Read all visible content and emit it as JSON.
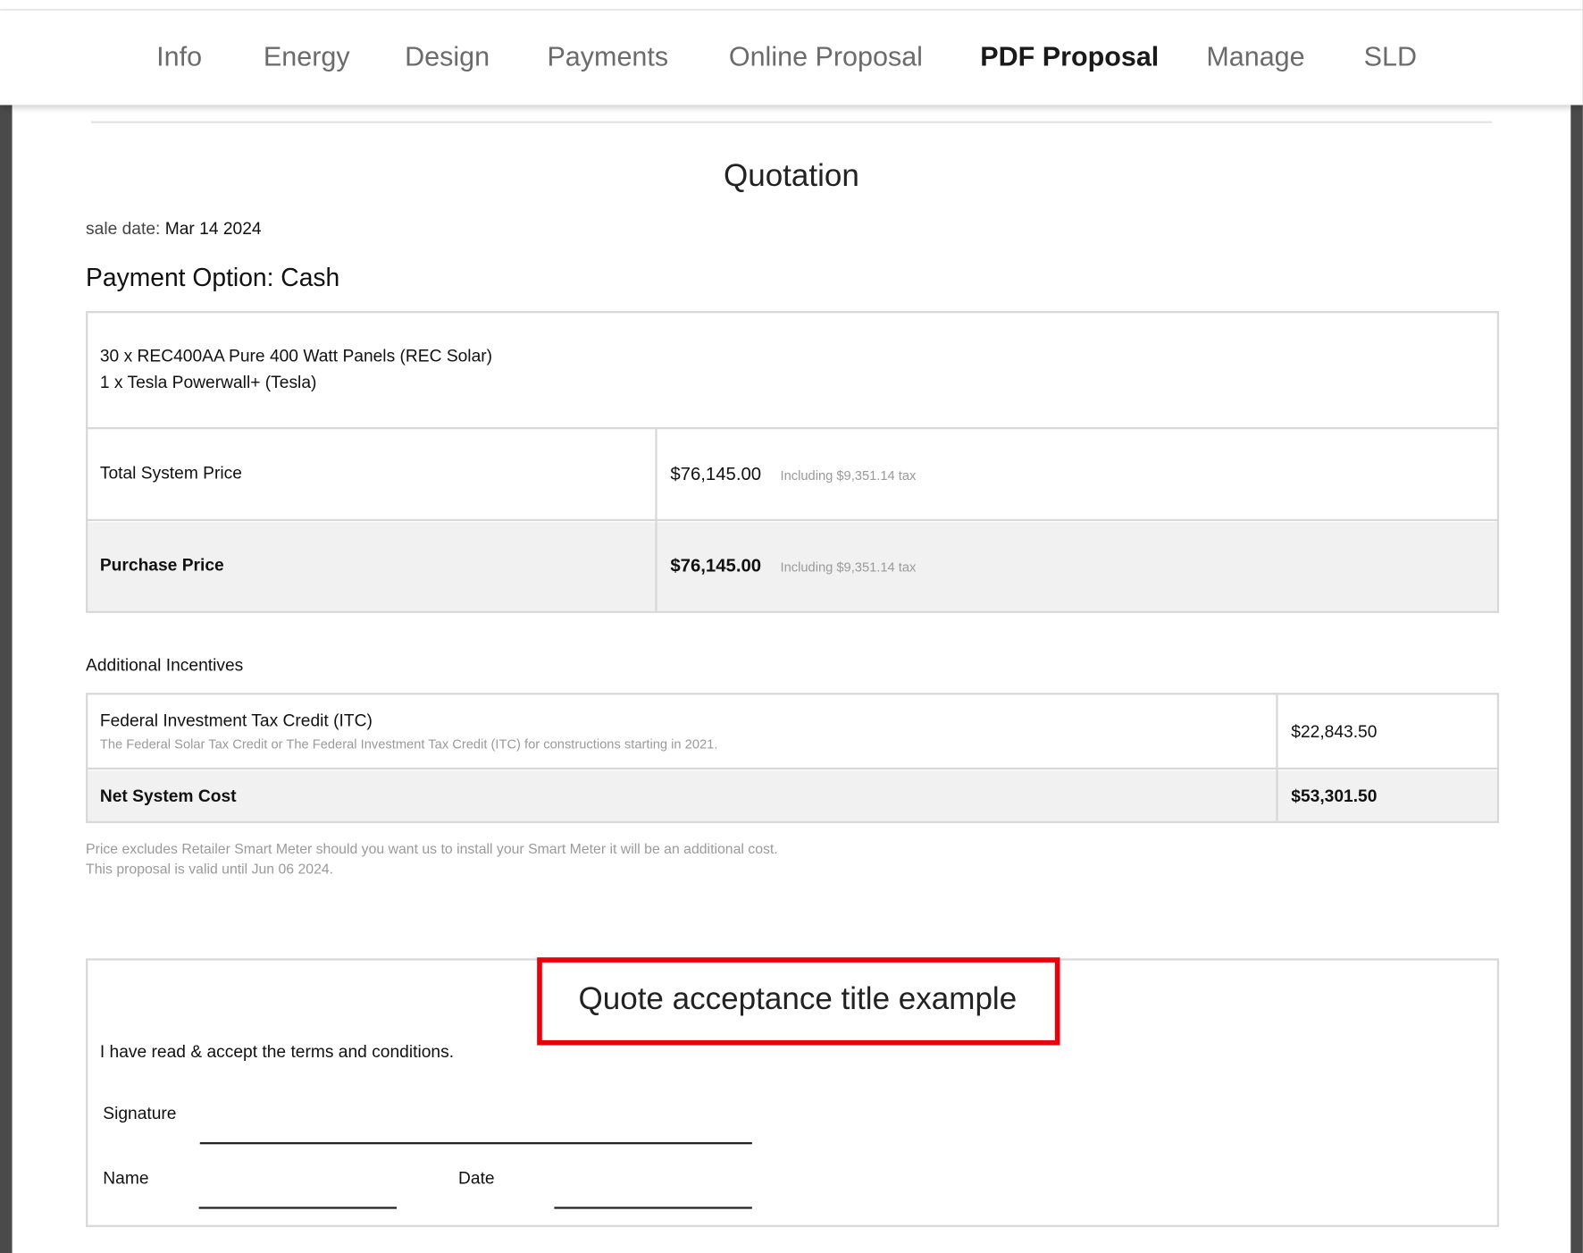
{
  "tabs": [
    {
      "label": "Info"
    },
    {
      "label": "Energy"
    },
    {
      "label": "Design"
    },
    {
      "label": "Payments"
    },
    {
      "label": "Online Proposal"
    },
    {
      "label": "PDF Proposal",
      "active": true
    },
    {
      "label": "Manage"
    },
    {
      "label": "SLD"
    }
  ],
  "document": {
    "title": "Quotation",
    "sale_date_label": "sale date:",
    "sale_date_value": "Mar 14 2024",
    "payment_option": "Payment Option: Cash",
    "system_lines": [
      "30 x REC400AA Pure 400 Watt Panels (REC Solar)",
      "1 x Tesla Powerwall+ (Tesla)"
    ],
    "total_system_price": {
      "label": "Total System Price",
      "value": "$76,145.00",
      "tax_note": "Including $9,351.14 tax"
    },
    "purchase_price": {
      "label": "Purchase Price",
      "value": "$76,145.00",
      "tax_note": "Including $9,351.14 tax"
    },
    "incentives_heading": "Additional Incentives",
    "itc": {
      "label": "Federal Investment Tax Credit (ITC)",
      "description": "The Federal Solar Tax Credit or The Federal Investment Tax Credit (ITC) for constructions starting in 2021.",
      "value": "$22,843.50"
    },
    "net_cost": {
      "label": "Net System Cost",
      "value": "$53,301.50"
    },
    "notes": [
      "Price excludes Retailer Smart Meter should you want us to install your Smart Meter it will be an additional cost.",
      "This proposal is valid until Jun 06 2024."
    ],
    "acceptance": {
      "title": "Quote acceptance title example",
      "terms": "I have read & accept the terms and conditions.",
      "signature_label": "Signature",
      "name_label": "Name",
      "date_label": "Date"
    }
  },
  "colors": {
    "highlight": "#e8000b",
    "shaded_row": "#f1f1f1",
    "active_tab": "#1a1a1a",
    "inactive_tab": "#6b6b6b"
  }
}
